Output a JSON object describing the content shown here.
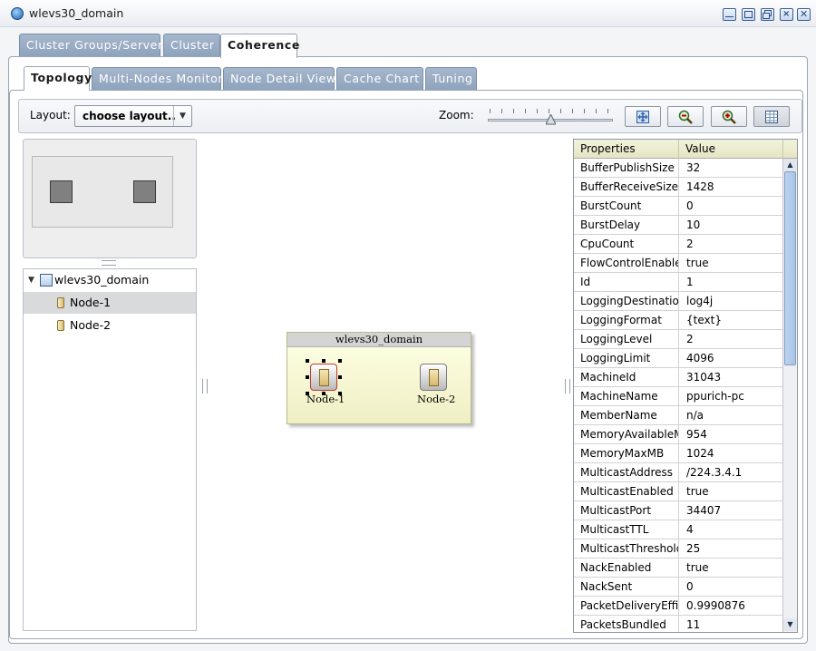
{
  "window": {
    "title": "wlevs30_domain"
  },
  "top_tabs": [
    {
      "label": "Cluster Groups/Server",
      "active": false
    },
    {
      "label": "Cluster",
      "active": false
    },
    {
      "label": "Coherence",
      "active": true
    }
  ],
  "sub_tabs": [
    {
      "label": "Topology",
      "active": true
    },
    {
      "label": "Multi-Nodes Monitor",
      "active": false
    },
    {
      "label": "Node Detail View",
      "active": false
    },
    {
      "label": "Cache Chart",
      "active": false
    },
    {
      "label": "Tuning",
      "active": false
    }
  ],
  "toolbar": {
    "layout_label": "Layout:",
    "layout_value": "choose layout..",
    "zoom_label": "Zoom:",
    "zoom_level": 0.5
  },
  "tree": {
    "root": "wlevs30_domain",
    "nodes": [
      "Node-1",
      "Node-2"
    ],
    "selected_index": 0
  },
  "canvas": {
    "group_title": "wlevs30_domain",
    "nodes": [
      "Node-1",
      "Node-2"
    ]
  },
  "properties": {
    "headers": [
      "Properties",
      "Value"
    ],
    "rows": [
      [
        "BufferPublishSize",
        "32"
      ],
      [
        "BufferReceiveSize",
        "1428"
      ],
      [
        "BurstCount",
        "0"
      ],
      [
        "BurstDelay",
        "10"
      ],
      [
        "CpuCount",
        "2"
      ],
      [
        "FlowControlEnable",
        "true"
      ],
      [
        "Id",
        "1"
      ],
      [
        "LoggingDestinatior",
        "log4j"
      ],
      [
        "LoggingFormat",
        "{text}"
      ],
      [
        "LoggingLevel",
        "2"
      ],
      [
        "LoggingLimit",
        "4096"
      ],
      [
        "MachineId",
        "31043"
      ],
      [
        "MachineName",
        "ppurich-pc"
      ],
      [
        "MemberName",
        "n/a"
      ],
      [
        "MemoryAvailableME",
        "954"
      ],
      [
        "MemoryMaxMB",
        "1024"
      ],
      [
        "MulticastAddress",
        "/224.3.4.1"
      ],
      [
        "MulticastEnabled",
        "true"
      ],
      [
        "MulticastPort",
        "34407"
      ],
      [
        "MulticastTTL",
        "4"
      ],
      [
        "MulticastThreshold",
        "25"
      ],
      [
        "NackEnabled",
        "true"
      ],
      [
        "NackSent",
        "0"
      ],
      [
        "PacketDeliveryEffici",
        "0.9990876"
      ],
      [
        "PacketsBundled",
        "11"
      ]
    ]
  }
}
